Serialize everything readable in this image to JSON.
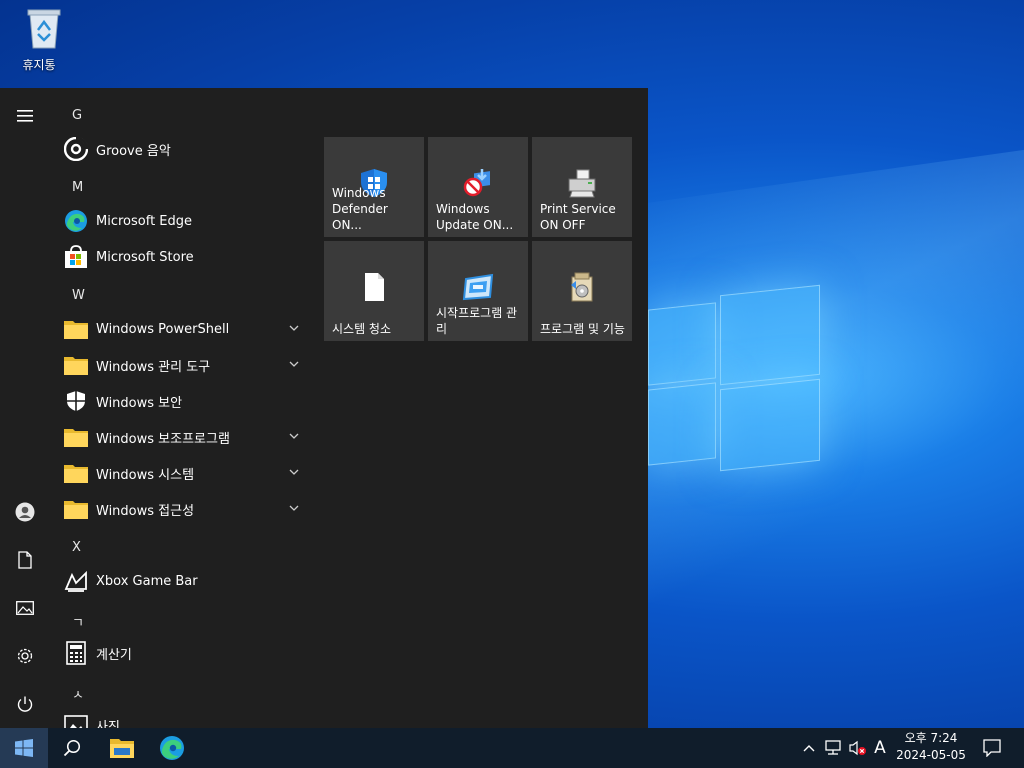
{
  "desktop": {
    "recycle_bin_label": "휴지통"
  },
  "start_menu": {
    "groups": [
      {
        "header": "G",
        "apps": [
          {
            "name": "Groove 음악",
            "icon": "groove-icon"
          }
        ]
      },
      {
        "header": "M",
        "apps": [
          {
            "name": "Microsoft Edge",
            "icon": "edge-icon"
          },
          {
            "name": "Microsoft Store",
            "icon": "store-icon"
          }
        ]
      },
      {
        "header": "W",
        "apps": [
          {
            "name": "Windows PowerShell",
            "icon": "folder-icon",
            "expandable": true
          },
          {
            "name": "Windows 관리 도구",
            "icon": "folder-icon",
            "expandable": true
          },
          {
            "name": "Windows 보안",
            "icon": "shield-icon",
            "expandable": false
          },
          {
            "name": "Windows 보조프로그램",
            "icon": "folder-icon",
            "expandable": true
          },
          {
            "name": "Windows 시스템",
            "icon": "folder-icon",
            "expandable": true
          },
          {
            "name": "Windows 접근성",
            "icon": "folder-icon",
            "expandable": true
          }
        ]
      },
      {
        "header": "X",
        "apps": [
          {
            "name": "Xbox Game Bar",
            "icon": "xbox-icon"
          }
        ]
      },
      {
        "header": "ㄱ",
        "apps": [
          {
            "name": "계산기",
            "icon": "calculator-icon"
          }
        ]
      },
      {
        "header": "ㅅ",
        "apps": [
          {
            "name": "사진",
            "icon": "photos-icon"
          }
        ]
      }
    ],
    "tiles": [
      {
        "label": "Windows Defender ON...",
        "icon": "defender-icon"
      },
      {
        "label": "Windows Update ON...",
        "icon": "update-icon"
      },
      {
        "label": "Print Service ON OFF",
        "icon": "printer-icon"
      },
      {
        "label": "시스템 청소",
        "icon": "document-icon"
      },
      {
        "label": "시작프로그램 관리",
        "icon": "startup-icon"
      },
      {
        "label": "프로그램 및 기능",
        "icon": "programs-icon"
      }
    ],
    "rail": [
      "menu-icon",
      "user-icon",
      "documents-icon",
      "pictures-icon",
      "settings-icon",
      "power-icon"
    ]
  },
  "taskbar": {
    "pinned": [
      "search-icon",
      "file-explorer-icon",
      "edge-icon"
    ],
    "tray": {
      "ime": "A",
      "time": "오후 7:24",
      "date": "2024-05-05"
    }
  },
  "colors": {
    "start_bg": "#1f1f1f",
    "tile_bg": "#3a3a3a",
    "taskbar_bg": "#101d2b",
    "accent": "#0a55c8"
  }
}
